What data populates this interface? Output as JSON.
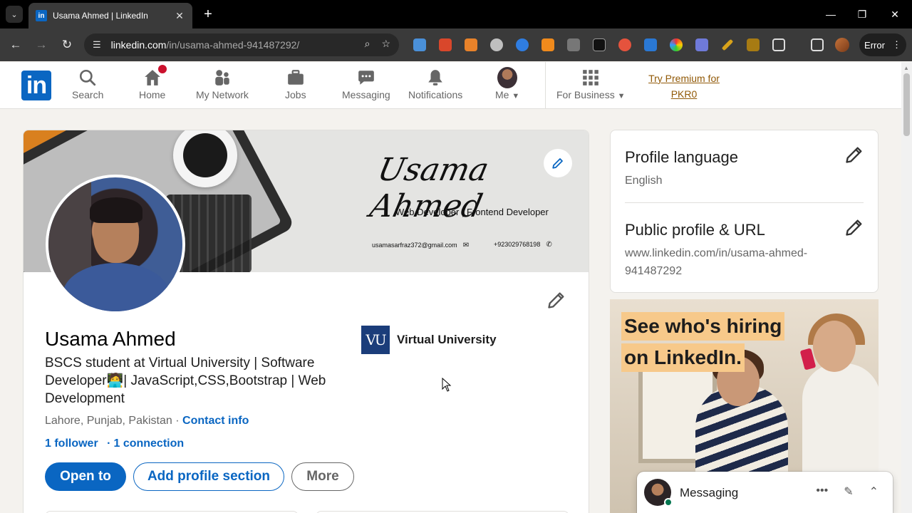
{
  "browser": {
    "tab_title": "Usama Ahmed | LinkedIn",
    "tab_favicon": "in",
    "url_domain": "linkedin.com",
    "url_path": "/in/usama-ahmed-941487292/",
    "error_label": "Error",
    "new_tab": "+",
    "tab_close": "✕"
  },
  "nav": {
    "logo": "in",
    "items": [
      {
        "label": "Search"
      },
      {
        "label": "Home"
      },
      {
        "label": "My Network"
      },
      {
        "label": "Jobs"
      },
      {
        "label": "Messaging"
      },
      {
        "label": "Notifications"
      },
      {
        "label": "Me"
      },
      {
        "label": "For Business"
      }
    ],
    "premium_line1": "Try Premium for",
    "premium_line2": "PKR0"
  },
  "profile": {
    "banner_signature": "Usama Ahmed",
    "banner_role": "Web Developer | Frontend Developer",
    "banner_email": "usamasarfraz372@gmail.com",
    "banner_phone": "+923029768198",
    "name": "Usama Ahmed",
    "headline": "BSCS student at Virtual University | Software Developer🧑‍💻| JavaScript,CSS,Bootstrap | Web Development",
    "location": "Lahore, Punjab, Pakistan",
    "location_sep": " · ",
    "contact_info": "Contact info",
    "followers": "1 follower",
    "connections_sep": "·",
    "connections": "1 connection",
    "education_logo": "VU",
    "education": "Virtual University",
    "buttons": {
      "open_to": "Open to",
      "add_section": "Add profile section",
      "more": "More"
    }
  },
  "sidebar": {
    "language_title": "Profile language",
    "language_value": "English",
    "public_title": "Public profile & URL",
    "public_url": "www.linkedin.com/in/usama-ahmed-941487292"
  },
  "ad": {
    "line1": "See who's hiring",
    "line2": "on LinkedIn."
  },
  "messaging": {
    "title": "Messaging"
  },
  "colors": {
    "linkedin_blue": "#0a66c2",
    "premium_gold": "#915907",
    "notification_red": "#cb112d",
    "online_green": "#01754f"
  }
}
